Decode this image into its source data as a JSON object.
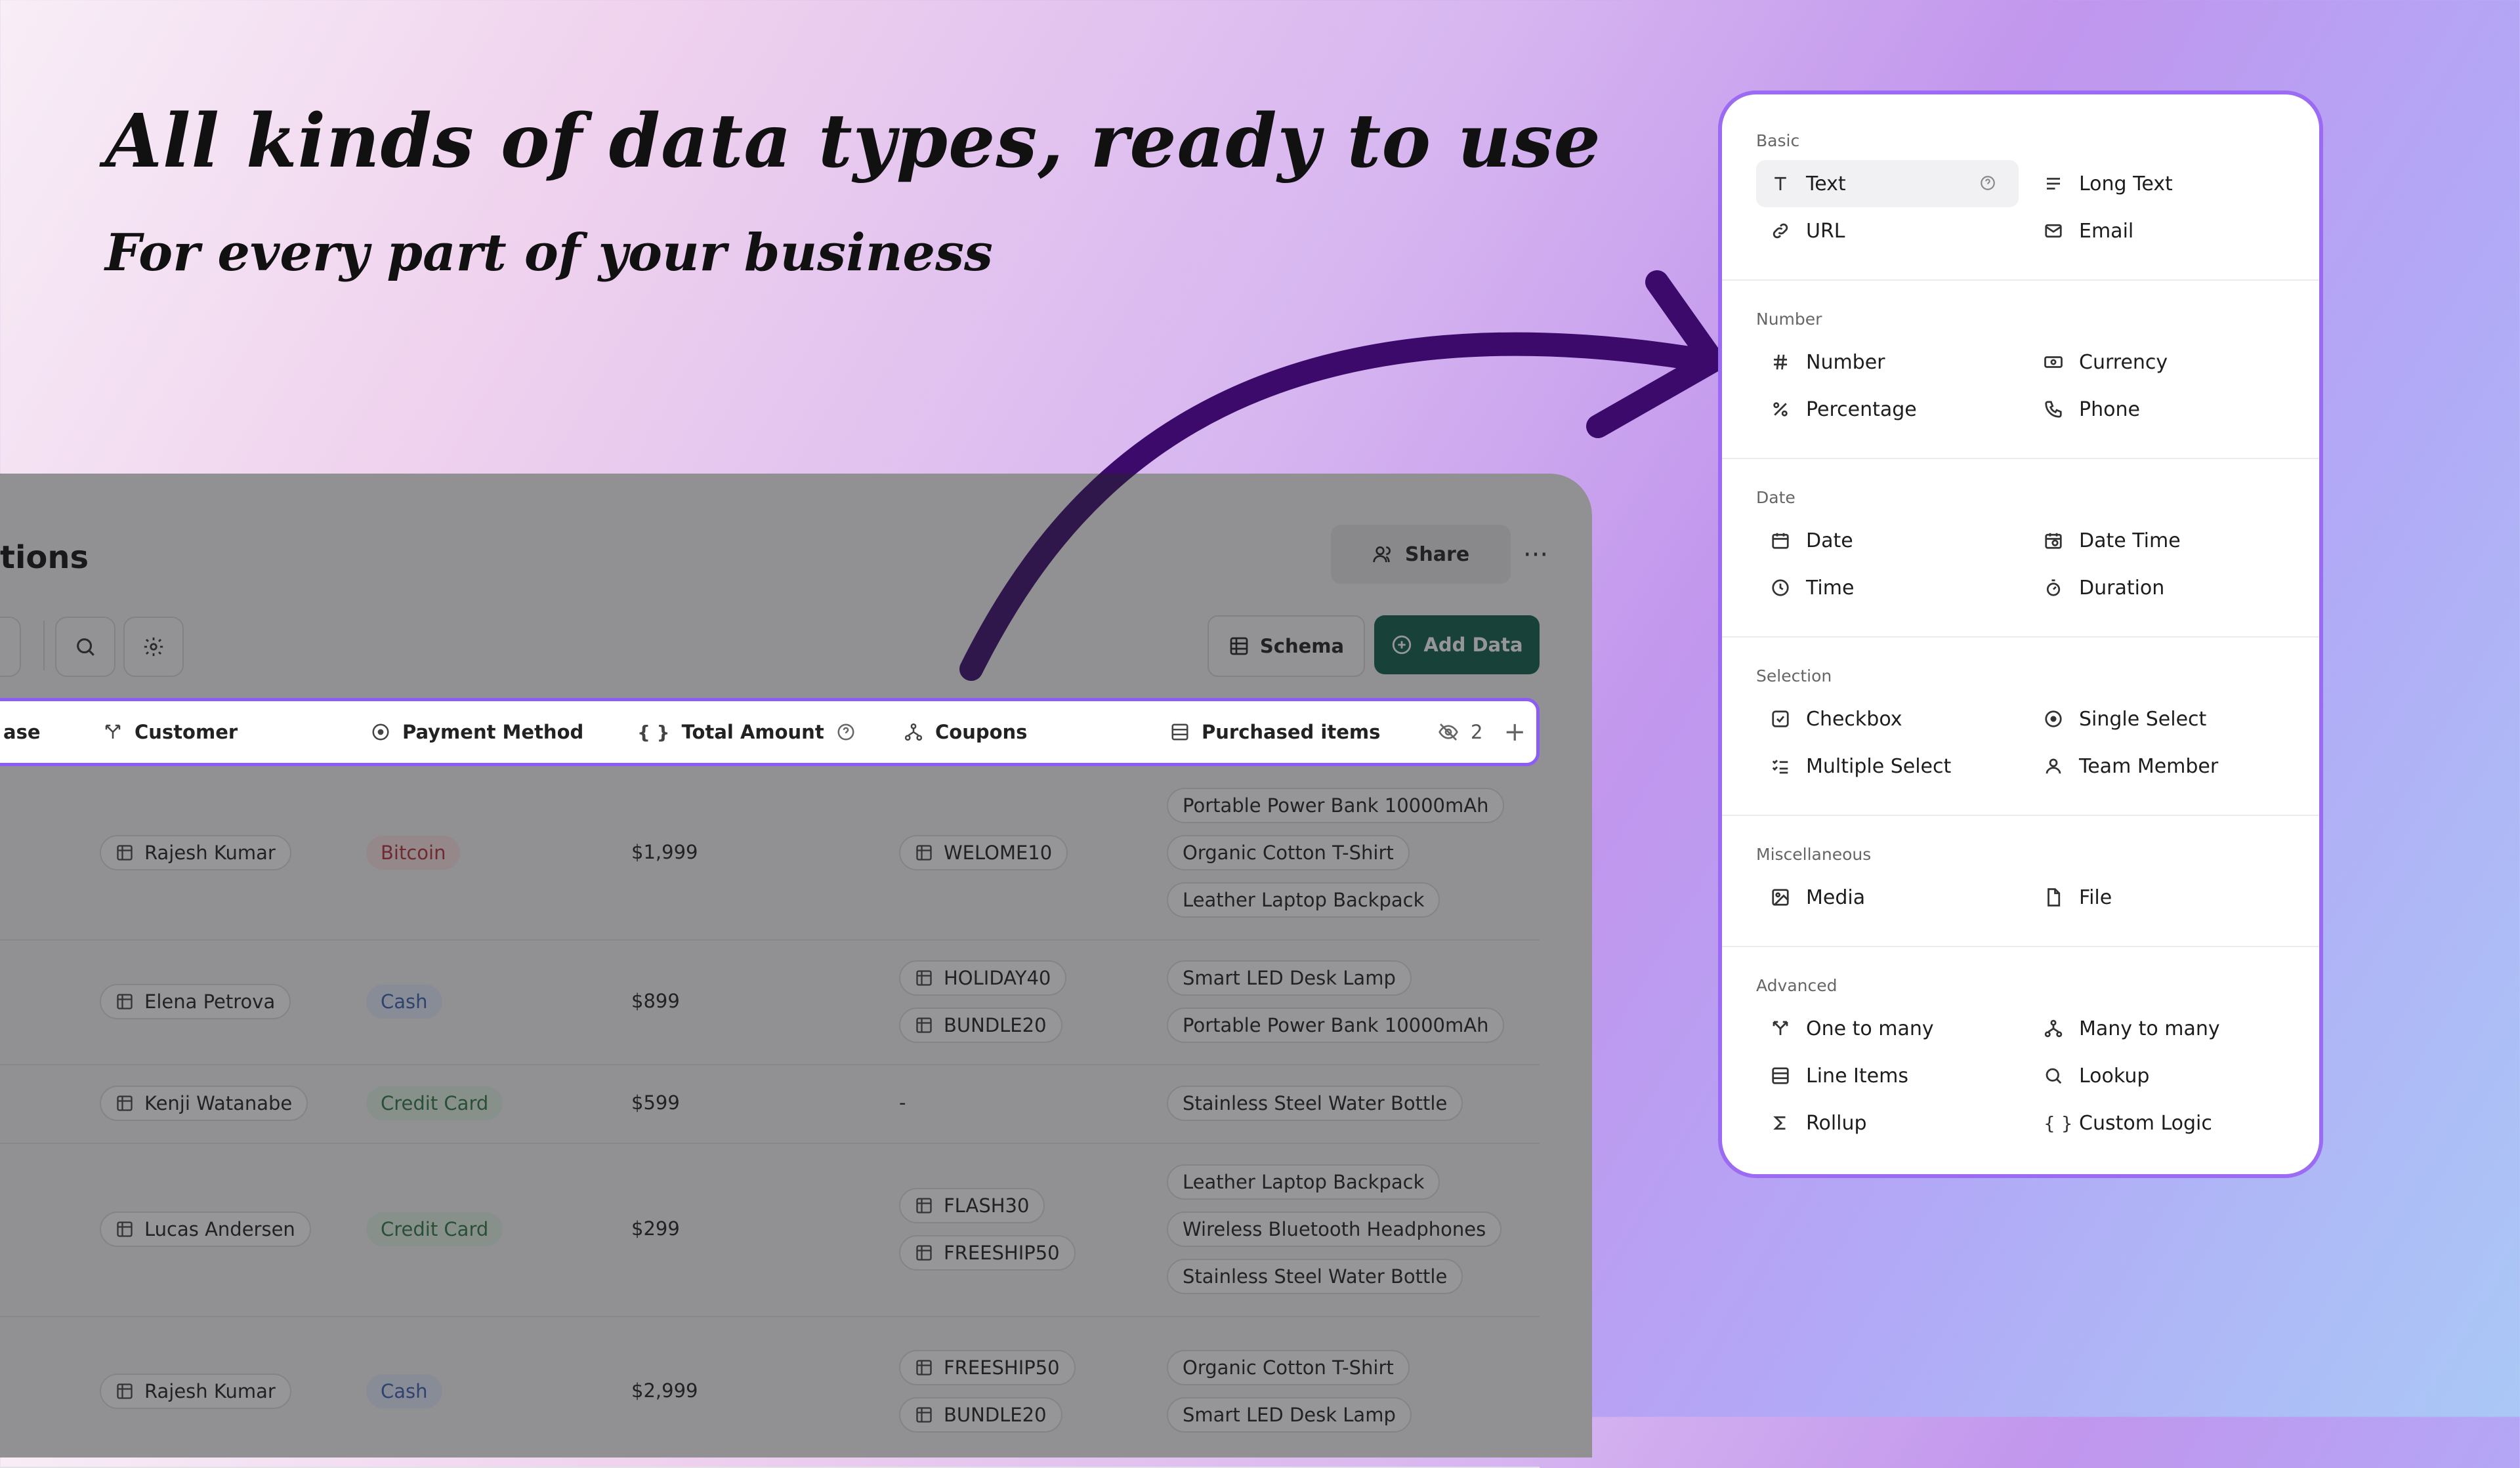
{
  "hero": {
    "title": "All kinds of data types, ready to use",
    "subtitle": "For every part of your business"
  },
  "table": {
    "title_fragment": "tions",
    "share_label": "Share",
    "schema_label": "Schema",
    "add_data_label": "Add Data",
    "hidden_count": "2",
    "columns": [
      {
        "label": "ase",
        "icon": "partial-icon"
      },
      {
        "label": "Customer",
        "icon": "one-to-many-icon"
      },
      {
        "label": "Payment Method",
        "icon": "single-select-icon"
      },
      {
        "label": "Total Amount",
        "icon": "custom-logic-icon"
      },
      {
        "label": "Coupons",
        "icon": "many-to-many-icon"
      },
      {
        "label": "Purchased items",
        "icon": "line-items-icon"
      }
    ],
    "rows": [
      {
        "customer": "Rajesh Kumar",
        "payment": "Bitcoin",
        "total": "$1,999",
        "coupons": [
          "WELOME10"
        ],
        "items": [
          "Portable Power Bank 10000mAh",
          "Organic Cotton T-Shirt",
          "Leather Laptop Backpack"
        ]
      },
      {
        "customer": "Elena Petrova",
        "payment": "Cash",
        "total": "$899",
        "coupons": [
          "HOLIDAY40",
          "BUNDLE20"
        ],
        "items": [
          "Smart LED Desk Lamp",
          "Portable Power Bank 10000mAh"
        ]
      },
      {
        "customer": "Kenji Watanabe",
        "payment": "Credit Card",
        "total": "$599",
        "coupons_empty": "-",
        "items": [
          "Stainless Steel Water Bottle"
        ]
      },
      {
        "customer": "Lucas Andersen",
        "payment": "Credit Card",
        "total": "$299",
        "coupons": [
          "FLASH30",
          "FREESHIP50"
        ],
        "items": [
          "Leather Laptop Backpack",
          "Wireless Bluetooth Headphones",
          "Stainless Steel Water Bottle"
        ]
      },
      {
        "customer": "Rajesh Kumar",
        "payment": "Cash",
        "total": "$2,999",
        "coupons": [
          "FREESHIP50",
          "BUNDLE20"
        ],
        "items": [
          "Organic Cotton T-Shirt",
          "Smart LED Desk Lamp"
        ]
      }
    ],
    "payment_colors": {
      "Bitcoin": "#b3323a",
      "Cash": "#3d5fb0",
      "Credit Card": "#2f7a46"
    }
  },
  "panel": {
    "sections": [
      {
        "label": "Basic",
        "items": [
          {
            "label": "Text",
            "icon": "text-icon",
            "selected": true
          },
          {
            "label": "Long Text",
            "icon": "long-text-icon"
          },
          {
            "label": "URL",
            "icon": "link-icon"
          },
          {
            "label": "Email",
            "icon": "email-icon"
          }
        ]
      },
      {
        "label": "Number",
        "items": [
          {
            "label": "Number",
            "icon": "hash-icon"
          },
          {
            "label": "Currency",
            "icon": "currency-icon"
          },
          {
            "label": "Percentage",
            "icon": "percent-icon"
          },
          {
            "label": "Phone",
            "icon": "phone-icon"
          }
        ]
      },
      {
        "label": "Date",
        "items": [
          {
            "label": "Date",
            "icon": "calendar-icon"
          },
          {
            "label": "Date Time",
            "icon": "calendar-clock-icon"
          },
          {
            "label": "Time",
            "icon": "clock-icon"
          },
          {
            "label": "Duration",
            "icon": "stopwatch-icon"
          }
        ]
      },
      {
        "label": "Selection",
        "items": [
          {
            "label": "Checkbox",
            "icon": "checkbox-icon"
          },
          {
            "label": "Single Select",
            "icon": "single-select-icon"
          },
          {
            "label": "Multiple Select",
            "icon": "multi-select-icon"
          },
          {
            "label": "Team Member",
            "icon": "user-icon"
          }
        ]
      },
      {
        "label": "Miscellaneous",
        "items": [
          {
            "label": "Media",
            "icon": "image-icon"
          },
          {
            "label": "File",
            "icon": "file-icon"
          }
        ]
      },
      {
        "label": "Advanced",
        "items": [
          {
            "label": "One to many",
            "icon": "one-to-many-icon"
          },
          {
            "label": "Many to many",
            "icon": "many-to-many-icon"
          },
          {
            "label": "Line Items",
            "icon": "line-items-icon"
          },
          {
            "label": "Lookup",
            "icon": "lookup-icon"
          },
          {
            "label": "Rollup",
            "icon": "sigma-icon"
          },
          {
            "label": "Custom Logic",
            "icon": "custom-logic-icon"
          }
        ]
      }
    ]
  },
  "colors": {
    "accent_border": "#9b6cf3",
    "arrow": "#3b0a6b",
    "add_button": "#0f5c4b"
  }
}
